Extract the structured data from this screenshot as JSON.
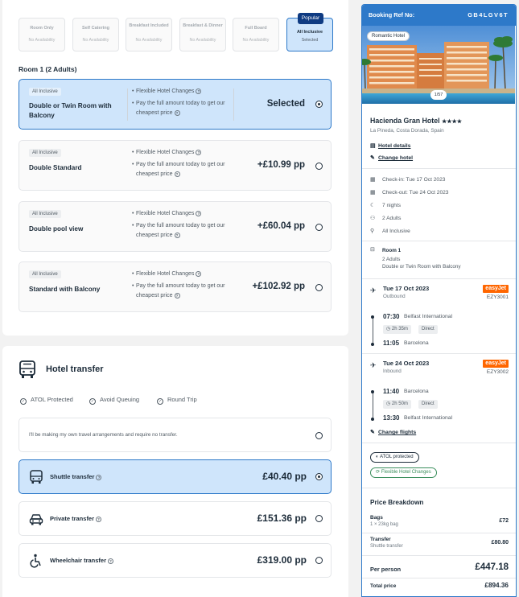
{
  "boards": [
    {
      "name": "Room Only",
      "status": "No Availability"
    },
    {
      "name": "Self Catering",
      "status": "No Availability"
    },
    {
      "name": "Breakfast Included",
      "status": "No Availability"
    },
    {
      "name": "Breakfast & Dinner",
      "status": "No Availability"
    },
    {
      "name": "Full Board",
      "status": "No Availability"
    },
    {
      "name": "All Inclusive",
      "status": "Selected",
      "badge": "Popular"
    }
  ],
  "room_heading": "Room 1 (2 Adults)",
  "rooms": [
    {
      "tag": "All Inclusive",
      "name": "Double or Twin Room with Balcony",
      "feature1": "Flexible Hotel Changes",
      "feature2": "Pay the full amount today to get our cheapest price",
      "price": "Selected"
    },
    {
      "tag": "All Inclusive",
      "name": "Double Standard",
      "feature1": "Flexible Hotel Changes",
      "feature2": "Pay the full amount today to get our cheapest price",
      "price": "+£10.99 pp"
    },
    {
      "tag": "All Inclusive",
      "name": "Double pool view",
      "feature1": "Flexible Hotel Changes",
      "feature2": "Pay the full amount today to get our cheapest price",
      "price": "+£60.04 pp"
    },
    {
      "tag": "All Inclusive",
      "name": "Standard with Balcony",
      "feature1": "Flexible Hotel Changes",
      "feature2": "Pay the full amount today to get our cheapest price",
      "price": "+£102.92 pp"
    }
  ],
  "transfer": {
    "title": "Hotel transfer",
    "perks": [
      "ATOL Protected",
      "Avoid Queuing",
      "Round Trip"
    ],
    "none_label": "I'll be making my own travel arrangements and require no transfer.",
    "options": [
      {
        "label": "Shuttle transfer",
        "price": "£40.40 pp"
      },
      {
        "label": "Private transfer",
        "price": "£151.36 pp"
      },
      {
        "label": "Wheelchair transfer",
        "price": "£319.00 pp"
      }
    ]
  },
  "booking": {
    "ref_label": "Booking Ref No:",
    "ref": "GB4LGV6T",
    "romantic": "Romantic Hotel",
    "image_count": "1/57",
    "hotel_name": "Hacienda Gran Hotel",
    "stars": "★★★★",
    "location": "La Pineda, Costa Dorada, Spain",
    "hotel_details": "Hotel details",
    "change_hotel": "Change hotel",
    "check_in": "Check-in: Tue 17 Oct 2023",
    "check_out": "Check-out: Tue 24 Oct 2023",
    "nights": "7 nights",
    "adults": "2 Adults",
    "board": "All Inclusive",
    "room_title": "Room 1",
    "room_adults": "2 Adults",
    "room_type": "Double or Twin Room with Balcony"
  },
  "flights": [
    {
      "date": "Tue 17 Oct 2023",
      "direction": "Outbound",
      "airline": "easyJet",
      "number": "EZY3001",
      "dep_time": "07:30",
      "dep_place": "Belfast International",
      "duration": "2h 35m",
      "stops": "Direct",
      "arr_time": "11:05",
      "arr_place": "Barcelona"
    },
    {
      "date": "Tue 24 Oct 2023",
      "direction": "Inbound",
      "airline": "easyJet",
      "number": "EZY3002",
      "dep_time": "11:40",
      "dep_place": "Barcelona",
      "duration": "2h 50m",
      "stops": "Direct",
      "arr_time": "13:30",
      "arr_place": "Belfast International"
    }
  ],
  "change_flights": "Change flights",
  "badges": {
    "atol": "ATOL protected",
    "flex": "Flexible Hotel Changes"
  },
  "price": {
    "title": "Price Breakdown",
    "bags_label": "Bags",
    "bags_sub": "1 × 23kg bag",
    "bags_value": "£72",
    "transfer_label": "Transfer",
    "transfer_sub": "Shuttle transfer",
    "transfer_value": "£80.80",
    "per_person_label": "Per person",
    "per_person_value": "£447.18",
    "total_label": "Total price",
    "total_value": "£894.36"
  },
  "colors": {
    "accent": "#2d79c9",
    "selected_bg": "#cfe5fb",
    "navy": "#0f3b82",
    "easyjet": "#ff6600"
  }
}
